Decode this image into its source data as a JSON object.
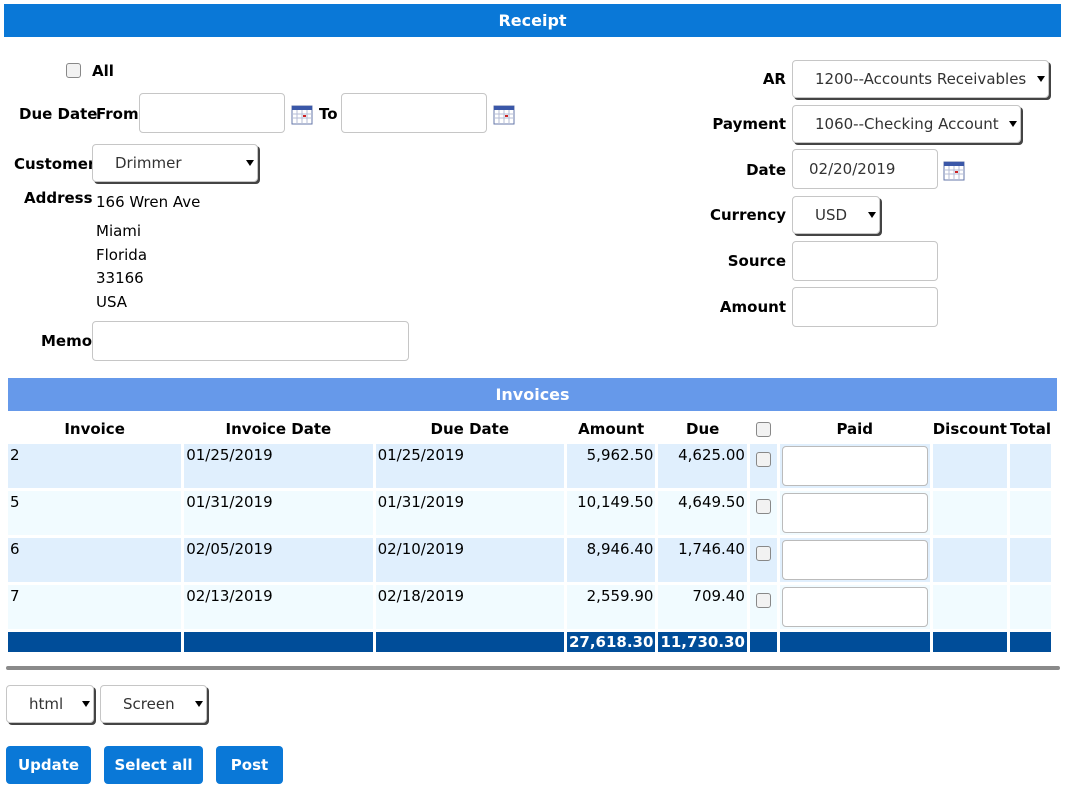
{
  "header": {
    "title": "Receipt"
  },
  "filters": {
    "all_label": "All",
    "due_date_label": "Due Date",
    "from_label": "From",
    "to_label": "To",
    "from_value": "",
    "to_value": ""
  },
  "customer": {
    "label": "Customer",
    "selected": "Drimmer",
    "address_label": "Address",
    "address_lines": [
      "166 Wren Ave",
      "Miami",
      "Florida",
      "33166",
      "USA"
    ]
  },
  "memo": {
    "label": "Memo",
    "value": ""
  },
  "right": {
    "ar_label": "AR",
    "ar_selected": "1200--Accounts Receivables",
    "payment_label": "Payment",
    "payment_selected": "1060--Checking Account",
    "date_label": "Date",
    "date_value": "02/20/2019",
    "currency_label": "Currency",
    "currency_selected": "USD",
    "source_label": "Source",
    "source_value": "",
    "amount_label": "Amount",
    "amount_value": ""
  },
  "invoices": {
    "title": "Invoices",
    "columns": [
      "Invoice",
      "Invoice Date",
      "Due Date",
      "Amount",
      "Due",
      "",
      "Paid",
      "Discount",
      "Total"
    ],
    "rows": [
      {
        "invoice": "2",
        "invoice_date": "01/25/2019",
        "due_date": "01/25/2019",
        "amount": "5,962.50",
        "due": "4,625.00"
      },
      {
        "invoice": "5",
        "invoice_date": "01/31/2019",
        "due_date": "01/31/2019",
        "amount": "10,149.50",
        "due": "4,649.50"
      },
      {
        "invoice": "6",
        "invoice_date": "02/05/2019",
        "due_date": "02/10/2019",
        "amount": "8,946.40",
        "due": "1,746.40"
      },
      {
        "invoice": "7",
        "invoice_date": "02/13/2019",
        "due_date": "02/18/2019",
        "amount": "2,559.90",
        "due": "709.40"
      }
    ],
    "totals": {
      "amount": "27,618.30",
      "due": "11,730.30"
    }
  },
  "footer": {
    "format_selected": "html",
    "media_selected": "Screen",
    "update_label": "Update",
    "select_all_label": "Select all",
    "post_label": "Post"
  },
  "colors": {
    "primary": "#0a78d7",
    "invoice_header": "#6699ea",
    "total_row": "#004d99",
    "row_even": "#e0effd",
    "row_odd": "#f1fbff"
  }
}
